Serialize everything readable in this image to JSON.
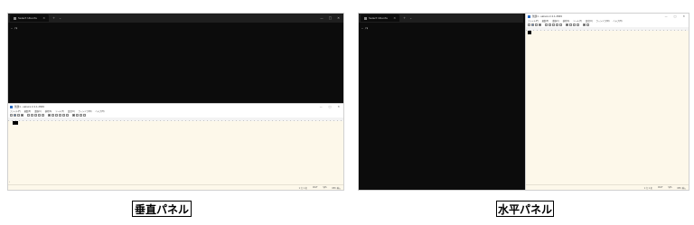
{
  "terminal": {
    "tab_title": "Select Ubuntu",
    "tab_close": "×",
    "new_tab": "+",
    "dropdown": "⌄",
    "prompt": "~ /$",
    "controls": {
      "minimize": "—",
      "maximize": "□",
      "close": "✕"
    }
  },
  "editor": {
    "title": "無題1 - sakura 2.4.1.2849",
    "menus": [
      "ファイル(F)",
      "編集(E)",
      "変換(C)",
      "検索(S)",
      "ツール(T)",
      "設定(O)",
      "ウィンドウ(W)",
      "ヘルプ(H)"
    ],
    "status": {
      "position": "1 行 1 桁",
      "line_end": "CRLF",
      "encoding": "SJIS",
      "mode": "REC 挿入"
    },
    "controls": {
      "minimize": "—",
      "maximize": "□",
      "close": "✕"
    }
  },
  "captions": {
    "vertical": "垂直パネル",
    "horizontal": "水平パネル"
  },
  "colors": {
    "terminal_bg": "#0c0c0c",
    "editor_bg": "#fdf8ea"
  }
}
